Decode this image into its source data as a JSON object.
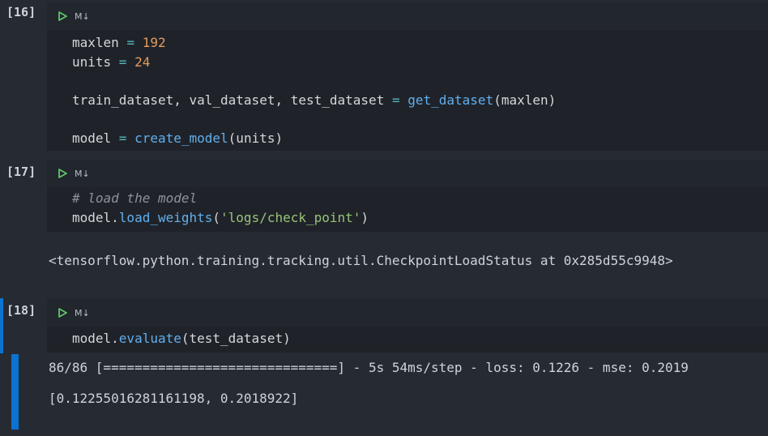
{
  "colors": {
    "background": "#262b33",
    "editor": "#1f2329",
    "toolbar": "#22262d",
    "focus_bar": "#0b73d1",
    "run_icon": "#5fc56b"
  },
  "toolbar": {
    "md_label": "M↓",
    "run_icon": "play-icon"
  },
  "cells": [
    {
      "prompt": "[16]",
      "code": {
        "l1_a": "maxlen ",
        "l1_op": "=",
        "l1_num": " 192",
        "l2_a": "units ",
        "l2_op": "=",
        "l2_num": " 24",
        "l3_a": "train_dataset, val_dataset, test_dataset ",
        "l3_op": "=",
        "l3_fn": " get_dataset",
        "l3_b": "(maxlen)",
        "l4_a": "model ",
        "l4_op": "=",
        "l4_fn": " create_model",
        "l4_b": "(units)"
      }
    },
    {
      "prompt": "[17]",
      "code": {
        "l1_comment": "# load the model",
        "l2_a": "model.",
        "l2_fn": "load_weights",
        "l2_b": "(",
        "l2_str": "'logs/check_point'",
        "l2_c": ")"
      },
      "output": "<tensorflow.python.training.tracking.util.CheckpointLoadStatus at 0x285d55c9948>"
    },
    {
      "prompt": "[18]",
      "code": {
        "l1_a": "model.",
        "l1_fn": "evaluate",
        "l1_b": "(test_dataset)"
      },
      "output_progress": "86/86 [==============================] - 5s 54ms/step - loss: 0.1226 - mse: 0.2019",
      "output_result": "[0.12255016281161198, 0.2018922]"
    }
  ]
}
